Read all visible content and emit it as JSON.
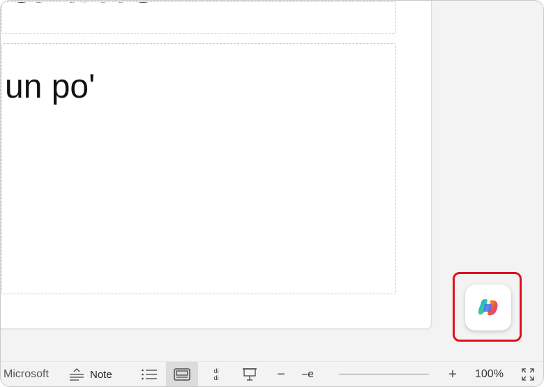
{
  "slide": {
    "title_text": "a titto",
    "body_text": "un po'"
  },
  "copilot": {
    "icon": "copilot-icon"
  },
  "statusbar": {
    "brand_text": "Microsoft",
    "notes_label": "Note",
    "sorter_glyph_top": "di",
    "sorter_glyph_bottom": "di",
    "zoom_out_glyph": "−",
    "zoom_thumb_text": "–e",
    "zoom_in_glyph": "+",
    "zoom_level": "100%"
  },
  "colors": {
    "highlight": "#e0101b",
    "active_view_bg": "#dcdcdc"
  }
}
